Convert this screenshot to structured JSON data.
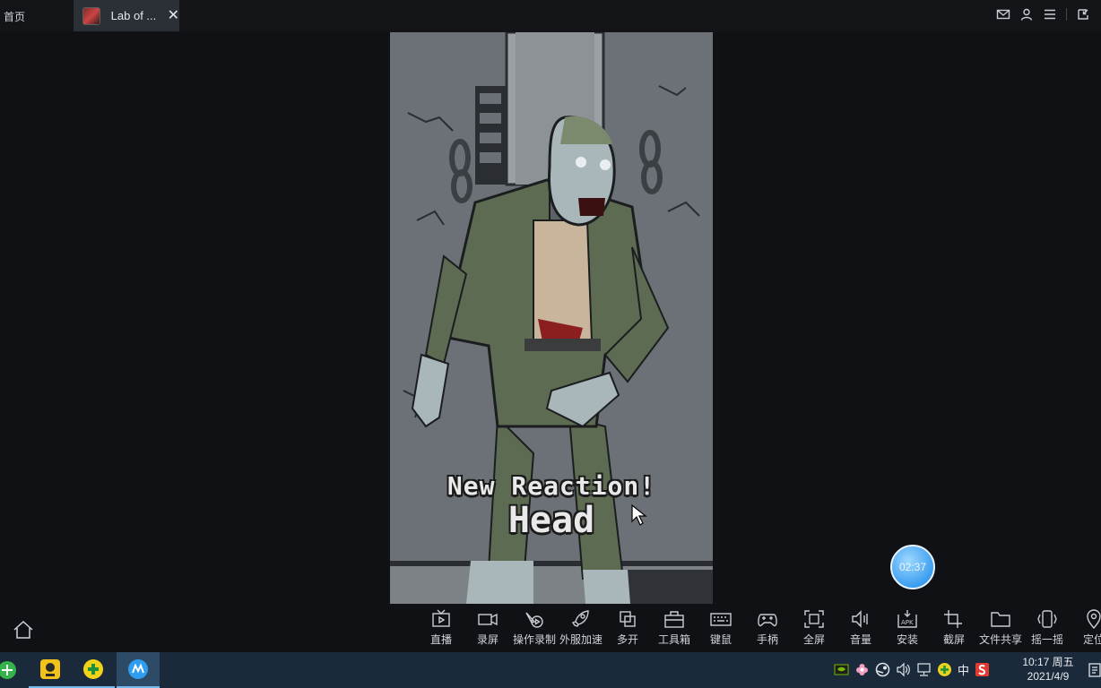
{
  "top_bar": {
    "home_tab": "首页",
    "active_tab": "Lab of ...",
    "close_glyph": "✕",
    "right_icons": [
      "mail-icon",
      "user-icon",
      "menu-icon",
      "minimize-icon"
    ]
  },
  "game": {
    "reaction_title": "New Reaction!",
    "reaction_name": "Head"
  },
  "timer": "02:37",
  "toolbar": {
    "items": [
      {
        "label": "直播",
        "icon": "live-tv-icon"
      },
      {
        "label": "录屏",
        "icon": "video-camera-icon"
      },
      {
        "label": "操作录制",
        "icon": "macro-record-icon"
      },
      {
        "label": "外服加速",
        "icon": "rocket-icon"
      },
      {
        "label": "多开",
        "icon": "multi-instance-icon"
      },
      {
        "label": "工具箱",
        "icon": "toolbox-icon"
      },
      {
        "label": "键鼠",
        "icon": "keyboard-icon"
      },
      {
        "label": "手柄",
        "icon": "gamepad-icon"
      },
      {
        "label": "全屏",
        "icon": "fullscreen-icon"
      },
      {
        "label": "音量",
        "icon": "volume-icon"
      },
      {
        "label": "安装",
        "icon": "apk-install-icon"
      },
      {
        "label": "截屏",
        "icon": "crop-icon"
      },
      {
        "label": "文件共享",
        "icon": "folder-icon"
      },
      {
        "label": "摇一摇",
        "icon": "shake-phone-icon"
      },
      {
        "label": "定位",
        "icon": "location-pin-icon"
      }
    ]
  },
  "taskbar": {
    "ime": "中",
    "time": "10:17 周五",
    "date": "2021/4/9"
  },
  "colors": {
    "background": "#0f1115",
    "taskbar": "#1b2a3a",
    "timer_blue": "#3b9ef0",
    "jacket_green": "#5d6b52"
  }
}
